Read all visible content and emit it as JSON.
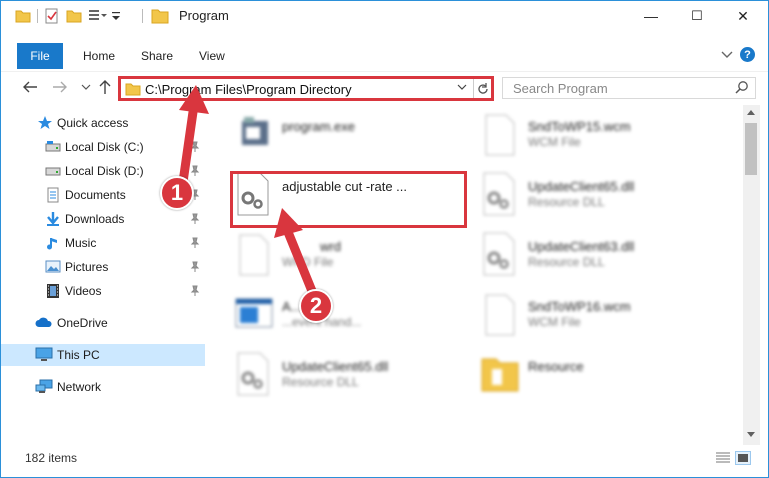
{
  "window": {
    "title": "Program",
    "controls": {
      "minimize": "—",
      "maximize": "☐",
      "close": "✕"
    }
  },
  "ribbon": {
    "tabs": [
      "File",
      "Home",
      "Share",
      "View"
    ],
    "help": "?"
  },
  "address": {
    "path": "C:\\Program Files\\Program Directory",
    "search_placeholder": "Search Program"
  },
  "sidebar": {
    "items": [
      {
        "label": "Quick access",
        "icon": "star-icon",
        "pinned": false
      },
      {
        "label": "Local Disk (C:)",
        "icon": "drive-icon",
        "pinned": true
      },
      {
        "label": "Local Disk (D:)",
        "icon": "drive-icon",
        "pinned": true
      },
      {
        "label": "Documents",
        "icon": "documents-icon",
        "pinned": true
      },
      {
        "label": "Downloads",
        "icon": "download-icon",
        "pinned": true
      },
      {
        "label": "Music",
        "icon": "music-icon",
        "pinned": true
      },
      {
        "label": "Pictures",
        "icon": "pictures-icon",
        "pinned": true
      },
      {
        "label": "Videos",
        "icon": "videos-icon",
        "pinned": true
      },
      {
        "label": "OneDrive",
        "icon": "cloud-icon",
        "pinned": false
      },
      {
        "label": "This PC",
        "icon": "pc-icon",
        "pinned": false,
        "selected": true
      },
      {
        "label": "Network",
        "icon": "network-icon",
        "pinned": false
      }
    ]
  },
  "files": [
    {
      "name": "program.exe",
      "type": "",
      "icon": "exe-icon",
      "blurred": true
    },
    {
      "name": "SndToWP15.wcm",
      "type": "WCM File",
      "icon": "blank-file-icon",
      "blurred": true
    },
    {
      "name": "adjustable cut -rate ...",
      "type": "",
      "icon": "dll-gear-icon",
      "blurred": false
    },
    {
      "name": "UpdateClient65.dll",
      "type": "Resource DLL",
      "icon": "dll-gear-icon",
      "blurred": true
    },
    {
      "name": "wrd",
      "type": "WRD File",
      "icon": "blank-file-icon",
      "blurred": true
    },
    {
      "name": "UpdateClient63.dll",
      "type": "Resource DLL",
      "icon": "dll-gear-icon",
      "blurred": true
    },
    {
      "name": "A...exe",
      "type": "...event hand...",
      "icon": "app-window-icon",
      "blurred": true
    },
    {
      "name": "SndToWP16.wcm",
      "type": "WCM File",
      "icon": "blank-file-icon",
      "blurred": true
    },
    {
      "name": "UpdateClient65.dll",
      "type": "Resource DLL",
      "icon": "dll-gear-icon",
      "blurred": true
    },
    {
      "name": "Resource",
      "type": "",
      "icon": "folder-icon",
      "blurred": true
    }
  ],
  "callouts": [
    "1",
    "2"
  ],
  "status": {
    "count": "182 items"
  },
  "colors": {
    "accent": "#1979ca",
    "highlight": "#d9363e",
    "selected": "#cce8ff"
  }
}
